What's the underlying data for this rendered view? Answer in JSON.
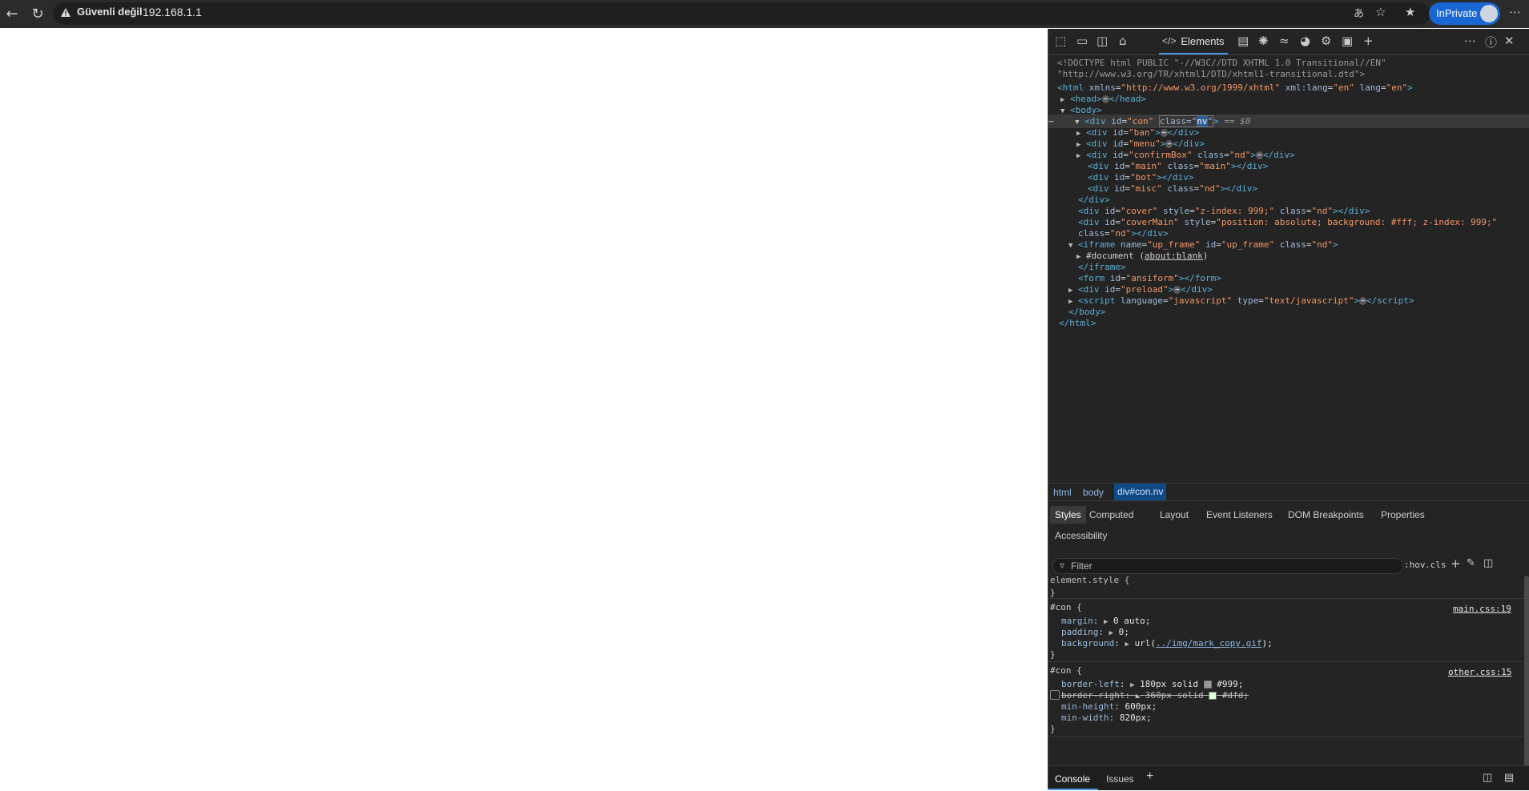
{
  "browser": {
    "security_label": "Güvenli değil",
    "url": "192.168.1.1",
    "inprivate_label": "InPrivate"
  },
  "devtools": {
    "active_tab": "Elements",
    "dom_lines": [
      "<!DOCTYPE html PUBLIC \"-//W3C//DTD XHTML 1.0 Transitional//EN\"",
      "\"http://www.w3.org/TR/xhtml1/DTD/xhtml1-transitional.dtd\">"
    ],
    "breadcrumb": [
      "html",
      "body",
      "div#con.nv"
    ],
    "subtabs": [
      "Styles",
      "Computed",
      "Layout",
      "Event Listeners",
      "DOM Breakpoints",
      "Properties",
      "Accessibility"
    ],
    "filter_placeholder": "Filter",
    "filter_buttons": [
      ":hov",
      ".cls"
    ],
    "styles": {
      "element_style": "element.style {",
      "close": "}",
      "rule1_selector": "#con {",
      "rule1_source": "main.css:19",
      "rule1_props": [
        {
          "name": "margin",
          "value": "0 auto;"
        },
        {
          "name": "padding",
          "value": "0;"
        },
        {
          "name": "background",
          "value_prefix": "url(",
          "link": "../img/mark_copy.gif",
          "value_suffix": ");"
        }
      ],
      "rule2_selector": "#con {",
      "rule2_source": "other.css:15",
      "rule2_props": [
        {
          "name": "border-left",
          "value": "180px solid",
          "color": "#999;",
          "swatch": "#999999"
        },
        {
          "name": "border-right",
          "value": "360px solid",
          "color": "#dfd;",
          "swatch": "#ddffdd"
        },
        {
          "name": "min-height",
          "value": "600px;"
        },
        {
          "name": "min-width",
          "value": "820px;"
        }
      ]
    },
    "console_tabs": [
      "Console",
      "Issues"
    ]
  }
}
